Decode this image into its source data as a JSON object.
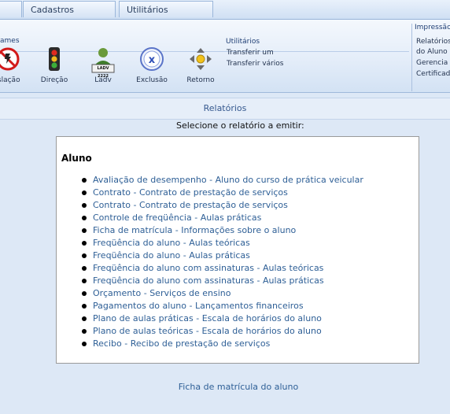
{
  "tabs": [
    {
      "label": ""
    },
    {
      "label": "Cadastros"
    },
    {
      "label": "Utilitários"
    }
  ],
  "ribbon": {
    "group_label": "ames",
    "buttons": [
      {
        "label": "islação",
        "icon": "no-entry-icon"
      },
      {
        "label": "Direção",
        "icon": "traffic-light-icon"
      },
      {
        "label": "Ladv",
        "icon": "ladv-card-icon",
        "badge": "LADV 2222"
      },
      {
        "label": "Exclusão",
        "icon": "exclusion-x-icon"
      },
      {
        "label": "Retorno",
        "icon": "return-arrows-icon"
      }
    ],
    "utilities": {
      "title": "Utilitários",
      "items": [
        "Transferir um",
        "Transferir vários"
      ]
    },
    "impressao": {
      "title": "Impressão",
      "items": [
        "Relatórios",
        "do Aluno",
        "Gerencia",
        "Certificad"
      ]
    }
  },
  "page": {
    "header": "Relatórios",
    "prompt": "Selecione o relatório a emitir:",
    "section_title": "Aluno",
    "reports": [
      "Avaliação de desempenho - Aluno do curso de prática veicular",
      "Contrato - Contrato de prestação de serviços",
      "Contrato - Contrato de prestação de serviços",
      "Controle de freqüência - Aulas práticas",
      "Ficha de matrícula - Informações sobre o aluno",
      "Freqüência do aluno - Aulas teóricas",
      "Freqüência do aluno - Aulas práticas",
      "Freqüência do aluno com assinaturas - Aulas teóricas",
      "Freqüência do aluno com assinaturas - Aulas práticas",
      "Orçamento - Serviços de ensino",
      "Pagamentos do aluno - Lançamentos financeiros",
      "Plano de aulas práticas - Escala de horários do aluno",
      "Plano de aulas teóricas - Escala de horários do aluno",
      "Recibo - Recibo de prestação de serviços"
    ],
    "selected_report": "Ficha de matrícula do aluno"
  }
}
